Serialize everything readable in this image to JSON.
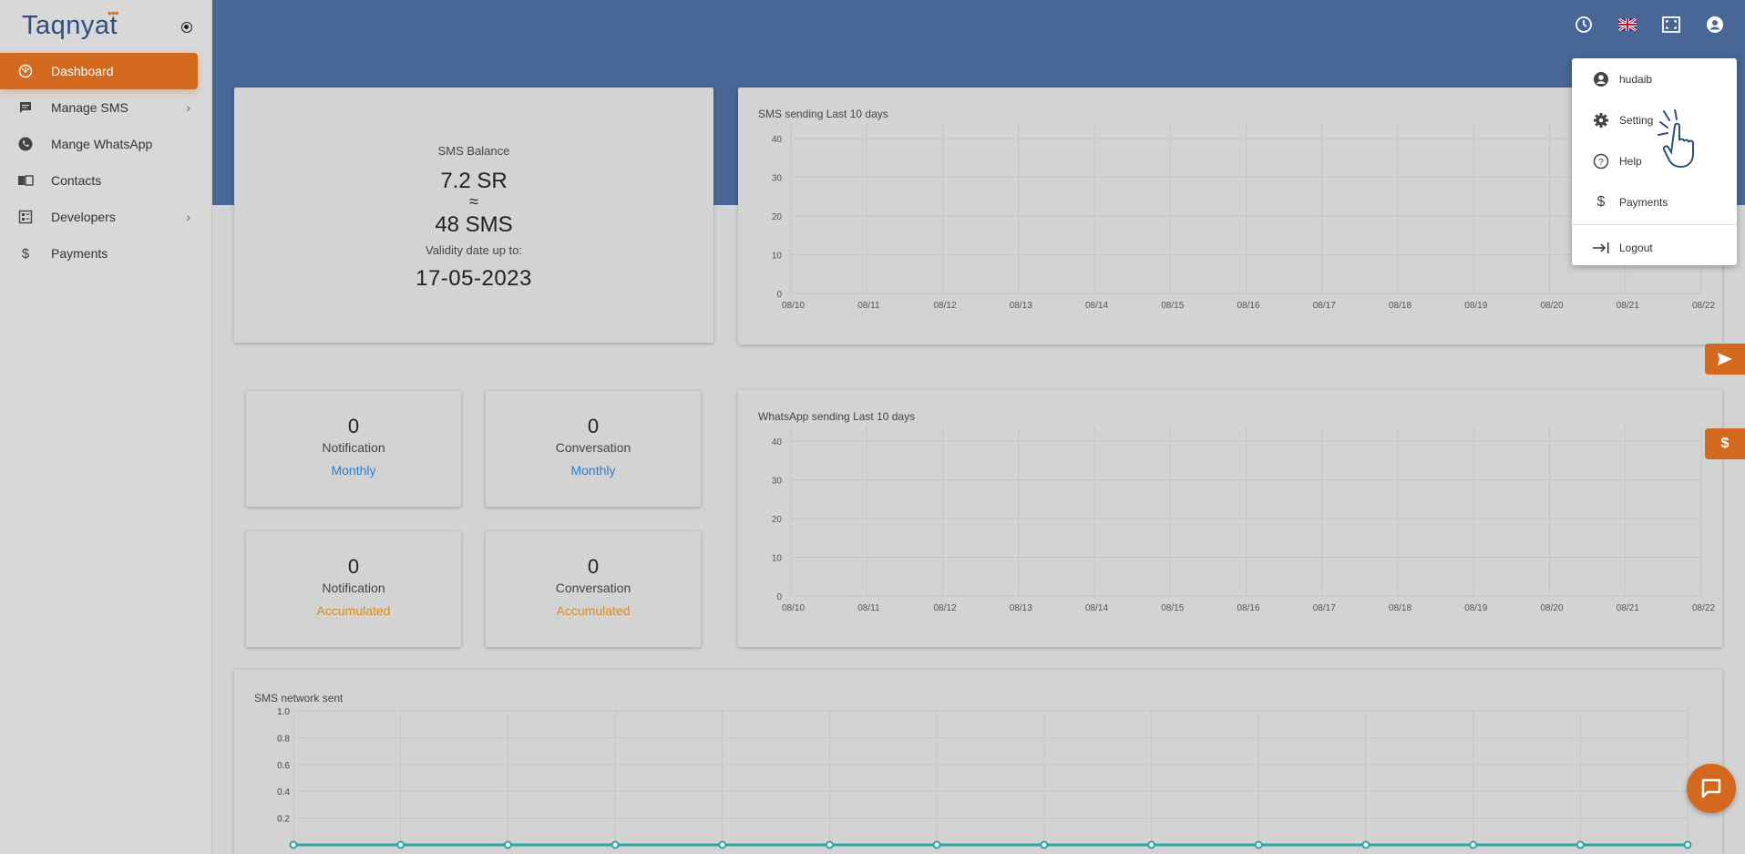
{
  "brand": {
    "name": "Taqnyat",
    "dots": "•••"
  },
  "sidebar": {
    "items": [
      {
        "label": "Dashboard",
        "icon": "dashboard-icon",
        "active": true
      },
      {
        "label": "Manage SMS",
        "icon": "sms-icon",
        "chevron": true
      },
      {
        "label": "Mange WhatsApp",
        "icon": "whatsapp-icon"
      },
      {
        "label": "Contacts",
        "icon": "contacts-icon"
      },
      {
        "label": "Developers",
        "icon": "developers-icon",
        "chevron": true
      },
      {
        "label": "Payments",
        "icon": "dollar-icon"
      }
    ]
  },
  "header": {
    "icons": [
      "clock-icon",
      "uk-flag-icon",
      "fullscreen-icon",
      "account-icon"
    ]
  },
  "balance": {
    "label": "SMS Balance",
    "sr": "7.2 SR",
    "approx": "≈",
    "sms": "48 SMS",
    "validity_label": "Validity date up to:",
    "validity_date": "17-05-2023"
  },
  "stats": [
    {
      "value": "0",
      "label": "Notification",
      "period": "Monthly"
    },
    {
      "value": "0",
      "label": "Conversation",
      "period": "Monthly"
    },
    {
      "value": "0",
      "label": "Notification",
      "period": "Accumulated"
    },
    {
      "value": "0",
      "label": "Conversation",
      "period": "Accumulated"
    }
  ],
  "dropdown": {
    "items": [
      {
        "label": "hudaib",
        "icon": "account-icon"
      },
      {
        "label": "Setting",
        "icon": "gear-icon"
      },
      {
        "label": "Help",
        "icon": "help-icon"
      },
      {
        "label": "Payments",
        "icon": "dollar-icon"
      },
      {
        "label": "Logout",
        "icon": "logout-icon"
      }
    ]
  },
  "colors": {
    "accent": "#d2691e",
    "band": "#486696",
    "line": "#2aa7a0"
  },
  "chart_data": [
    {
      "type": "line",
      "title": "SMS sending Last 10 days",
      "x": [
        "08/10",
        "08/11",
        "08/12",
        "08/13",
        "08/14",
        "08/15",
        "08/16",
        "08/17",
        "08/18",
        "08/19",
        "08/20",
        "08/21",
        "08/22"
      ],
      "yticks": [
        "0",
        "10",
        "20",
        "30",
        "40"
      ],
      "ylim": [
        0,
        40
      ],
      "grid": true
    },
    {
      "type": "line",
      "title": "WhatsApp sending Last 10 days",
      "x": [
        "08/10",
        "08/11",
        "08/12",
        "08/13",
        "08/14",
        "08/15",
        "08/16",
        "08/17",
        "08/18",
        "08/19",
        "08/20",
        "08/21",
        "08/22"
      ],
      "yticks": [
        "0",
        "10",
        "20",
        "30",
        "40"
      ],
      "ylim": [
        0,
        40
      ],
      "grid": true
    },
    {
      "type": "line",
      "title": "SMS network sent",
      "yticks": [
        "1.0",
        "0.8",
        "0.6",
        "0.4",
        "0.2"
      ],
      "ylim": [
        0,
        1
      ],
      "points": 14,
      "values": [
        0,
        0,
        0,
        0,
        0,
        0,
        0,
        0,
        0,
        0,
        0,
        0,
        0,
        0
      ],
      "grid": true
    }
  ]
}
